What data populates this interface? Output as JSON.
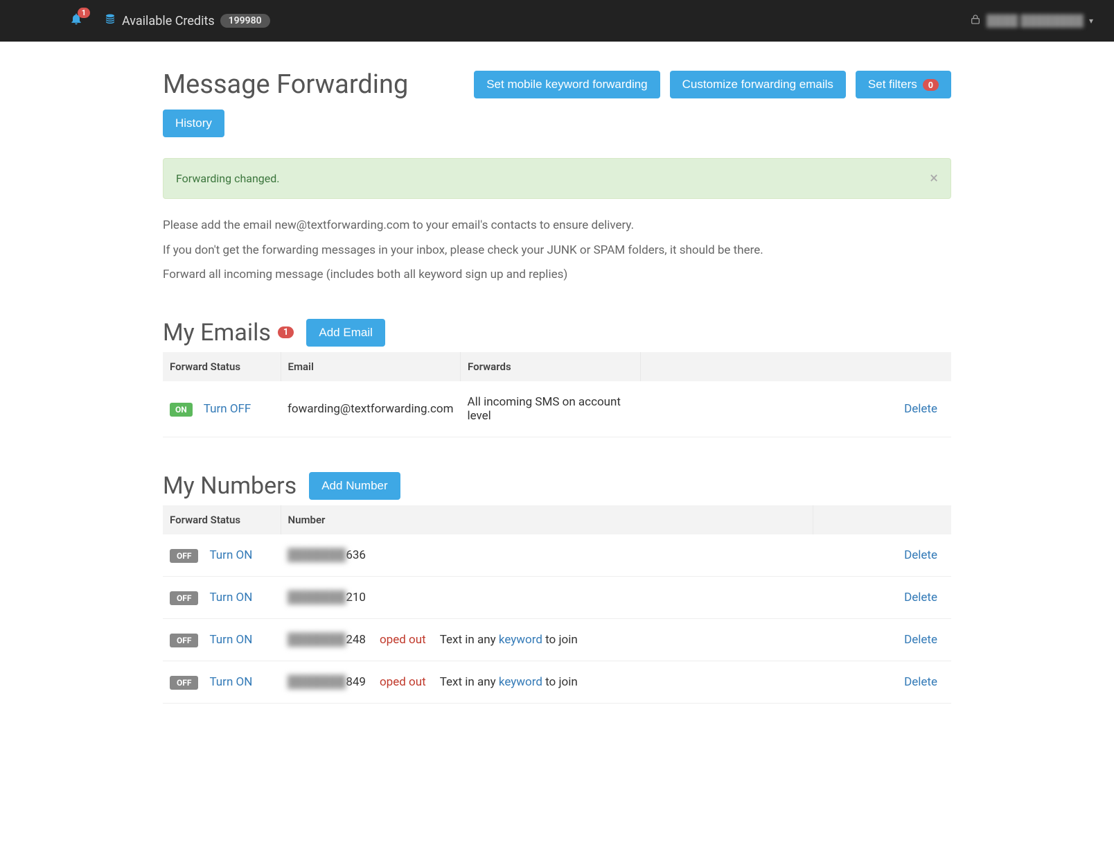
{
  "topbar": {
    "notification_count": "1",
    "credits_label": "Available Credits",
    "credits_value": "199980",
    "user_name": "████ ████████"
  },
  "page": {
    "title": "Message Forwarding",
    "buttons": {
      "set_mobile": "Set mobile keyword forwarding",
      "customize_emails": "Customize forwarding emails",
      "set_filters": "Set filters",
      "set_filters_count": "0",
      "history": "History"
    },
    "alert_text": "Forwarding changed.",
    "info_line1": "Please add the email new@textforwarding.com to your email's contacts to ensure delivery.",
    "info_line2": "If you don't get the forwarding messages in your inbox, please check your JUNK or SPAM folders, it should be there.",
    "info_line3": "Forward all incoming message (includes both all keyword sign up and replies)"
  },
  "emails": {
    "title": "My Emails",
    "count": "1",
    "add_label": "Add Email",
    "headers": {
      "status": "Forward Status",
      "email": "Email",
      "forwards": "Forwards"
    },
    "rows": [
      {
        "status_badge": "ON",
        "toggle_label": "Turn OFF",
        "email": "fowarding@textforwarding.com",
        "forwards": "All incoming SMS on account level",
        "delete_label": "Delete"
      }
    ]
  },
  "numbers": {
    "title": "My Numbers",
    "add_label": "Add Number",
    "headers": {
      "status": "Forward Status",
      "number": "Number"
    },
    "text_in_any": "Text in any ",
    "keyword_word": "keyword",
    "to_join": " to join",
    "rows": [
      {
        "status_badge": "OFF",
        "toggle_label": "Turn ON",
        "masked": "███████",
        "suffix": "636",
        "opted": "",
        "has_forward": false,
        "delete_label": "Delete"
      },
      {
        "status_badge": "OFF",
        "toggle_label": "Turn ON",
        "masked": "███████",
        "suffix": "210",
        "opted": "",
        "has_forward": false,
        "delete_label": "Delete"
      },
      {
        "status_badge": "OFF",
        "toggle_label": "Turn ON",
        "masked": "███████",
        "suffix": "248",
        "opted": "oped out",
        "has_forward": true,
        "delete_label": "Delete"
      },
      {
        "status_badge": "OFF",
        "toggle_label": "Turn ON",
        "masked": "███████",
        "suffix": "849",
        "opted": "oped out",
        "has_forward": true,
        "delete_label": "Delete"
      }
    ]
  }
}
